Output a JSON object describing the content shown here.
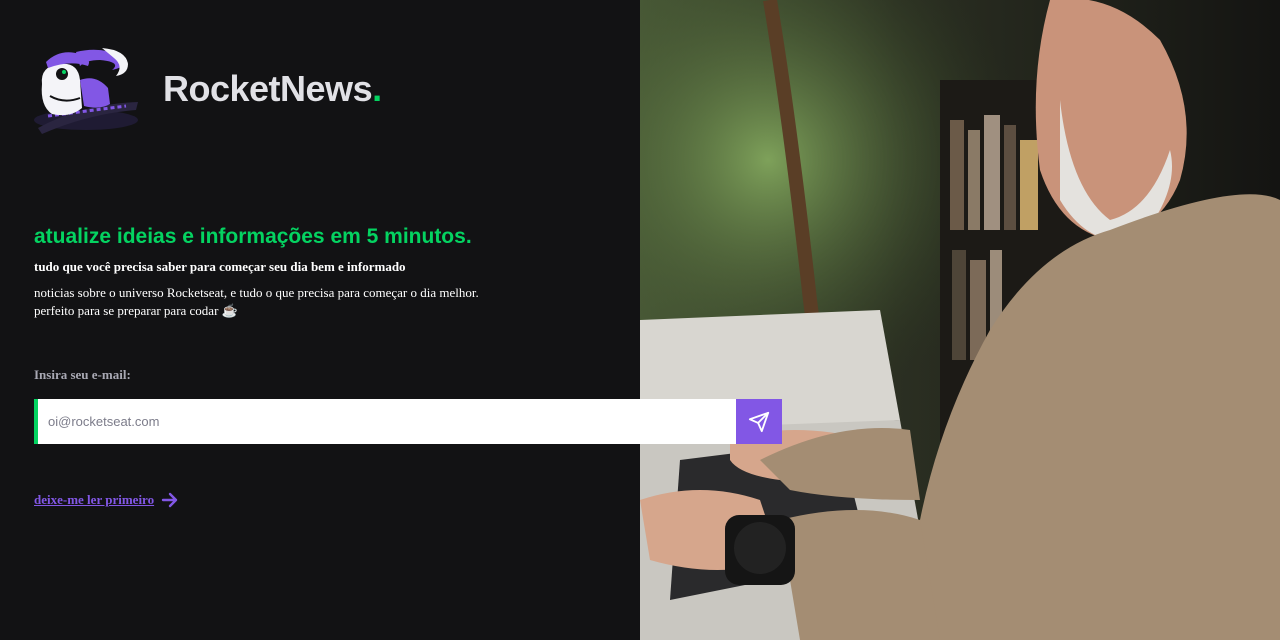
{
  "brand": {
    "name": "RocketNews",
    "dot": "."
  },
  "hero": {
    "headline": "atualize ideias e informações em 5 minutos.",
    "subheadline": "tudo que você precisa saber para começar seu dia bem e informado",
    "description_line1": "noticias sobre o universo Rocketseat, e tudo o que precisa para começar o dia melhor.",
    "description_line2": "perfeito para se preparar para codar",
    "coffee_emoji": "☕"
  },
  "form": {
    "email_label": "Insira seu e-mail:",
    "email_placeholder": "oi@rocketseat.com",
    "submit_icon": "send-icon"
  },
  "link": {
    "read_first": "deixe-me ler primeiro",
    "icon": "arrow-right-icon"
  },
  "colors": {
    "background": "#121214",
    "accent_green": "#04d361",
    "accent_purple": "#8257e5"
  }
}
